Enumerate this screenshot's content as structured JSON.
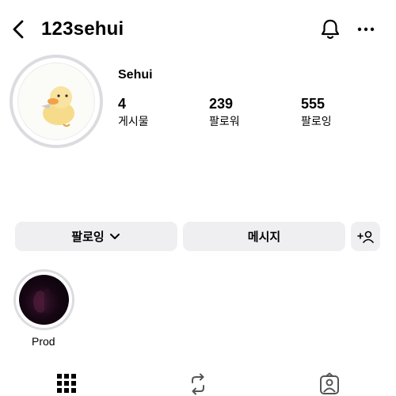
{
  "header": {
    "username": "123sehui",
    "icons": {
      "back": "chevron-left-icon",
      "notifications": "bell-icon",
      "more": "more-horizontal-icon"
    }
  },
  "profile": {
    "display_name": "Sehui",
    "avatar_icon": "duck-avatar",
    "stats": [
      {
        "value": "4",
        "label": "게시물"
      },
      {
        "value": "239",
        "label": "팔로워"
      },
      {
        "value": "555",
        "label": "팔로잉"
      }
    ]
  },
  "actions": {
    "following_label": "팔로잉",
    "following_icon": "chevron-down-icon",
    "message_label": "메시지",
    "add_user_icon": "add-user-icon"
  },
  "highlights": [
    {
      "label": "Prod"
    }
  ],
  "tabs": [
    {
      "name": "grid",
      "icon": "grid-icon"
    },
    {
      "name": "reposts",
      "icon": "repost-icon"
    },
    {
      "name": "tagged",
      "icon": "tagged-person-icon"
    }
  ],
  "colors": {
    "button_bg": "#efeff2",
    "ring": "#dcdce0",
    "text": "#000000"
  }
}
